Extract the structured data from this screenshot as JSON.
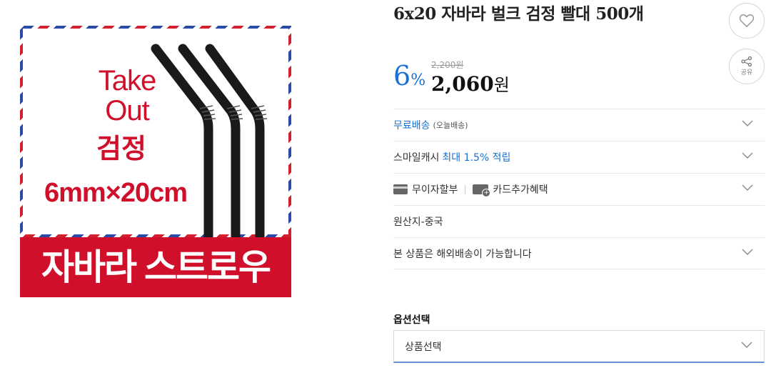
{
  "product": {
    "title": "6x20 자바라 벌크 검정 빨대 500개",
    "image": {
      "text_line1": "Take",
      "text_line2": "Out",
      "color_text": "검정",
      "size_text": "6mm×20cm",
      "brand_text": "자바라 스트로우"
    },
    "discount_number": "6",
    "discount_unit": "%",
    "original_price": "2,200원",
    "sale_price": "2,060",
    "sale_unit": "원"
  },
  "actions": {
    "like_icon": "heart-icon",
    "share_icon": "share-icon",
    "share_label": "공유"
  },
  "info": {
    "shipping": "무료배송",
    "shipping_note": "(오늘배송)",
    "cash_prefix": "스마일캐시 ",
    "cash_highlight": "최대 1.5% 적립",
    "installment": "무이자할부",
    "card_benefit": "카드추가혜택",
    "origin": "원산지-중국",
    "overseas": "본 상품은 해외배송이 가능합니다"
  },
  "option": {
    "label": "옵션선택",
    "placeholder": "상품선택"
  },
  "colors": {
    "accent": "#1a6fd4",
    "brand_red": "#d0102a"
  }
}
